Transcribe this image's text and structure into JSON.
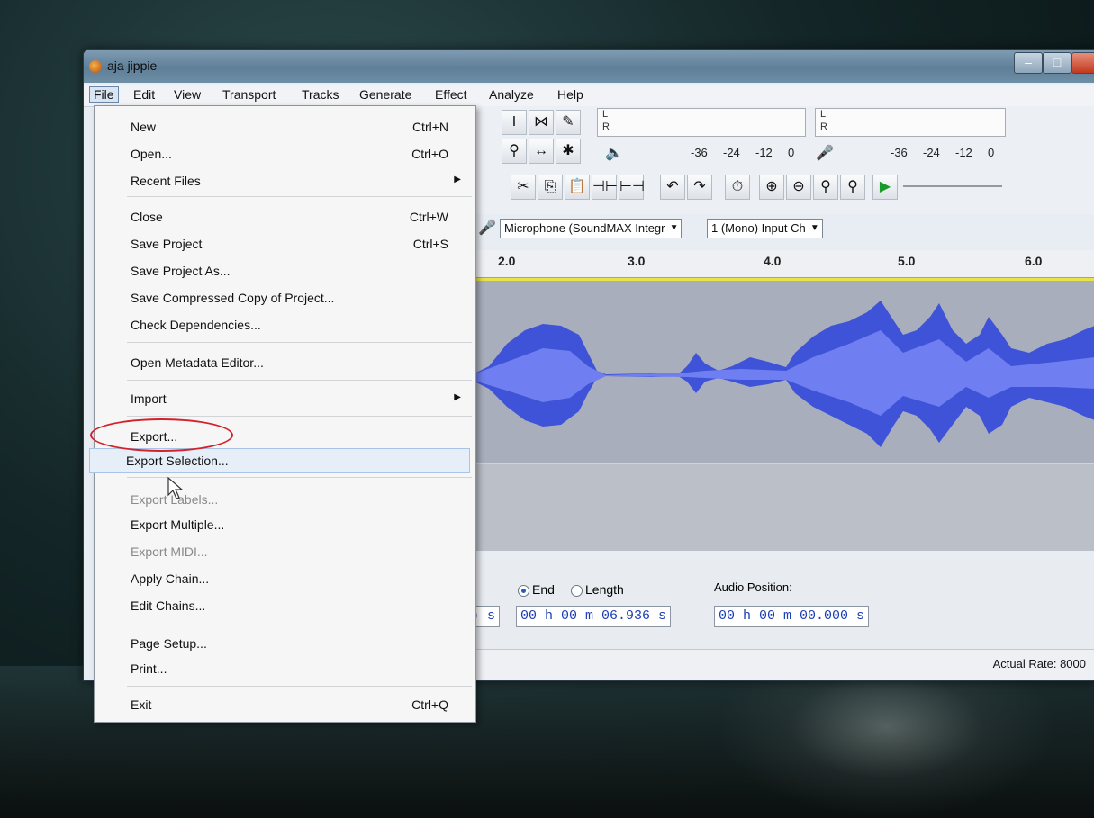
{
  "window": {
    "title": "aja jippie"
  },
  "menubar": [
    "File",
    "Edit",
    "View",
    "Transport",
    "Tracks",
    "Generate",
    "Effect",
    "Analyze",
    "Help"
  ],
  "file_menu": {
    "items": [
      {
        "label": "New",
        "shortcut": "Ctrl+N"
      },
      {
        "label": "Open...",
        "shortcut": "Ctrl+O"
      },
      {
        "label": "Recent Files",
        "shortcut": ""
      },
      {
        "label": "Close",
        "shortcut": "Ctrl+W"
      },
      {
        "label": "Save Project",
        "shortcut": "Ctrl+S"
      },
      {
        "label": "Save Project As...",
        "shortcut": ""
      },
      {
        "label": "Save Compressed Copy of Project...",
        "shortcut": ""
      },
      {
        "label": "Check Dependencies...",
        "shortcut": ""
      },
      {
        "label": "Open Metadata Editor...",
        "shortcut": ""
      },
      {
        "label": "Import",
        "shortcut": ""
      },
      {
        "label": "Export...",
        "shortcut": ""
      },
      {
        "label": "Export Selection...",
        "shortcut": ""
      },
      {
        "label": "Export Labels...",
        "shortcut": ""
      },
      {
        "label": "Export Multiple...",
        "shortcut": ""
      },
      {
        "label": "Export MIDI...",
        "shortcut": ""
      },
      {
        "label": "Apply Chain...",
        "shortcut": ""
      },
      {
        "label": "Edit Chains...",
        "shortcut": ""
      },
      {
        "label": "Page Setup...",
        "shortcut": ""
      },
      {
        "label": "Print...",
        "shortcut": ""
      },
      {
        "label": "Exit",
        "shortcut": "Ctrl+Q"
      }
    ]
  },
  "meters": {
    "play_l": "L",
    "play_r": "R",
    "rec_l": "L",
    "rec_r": "R",
    "scale": [
      "-36",
      "-24",
      "-12",
      "0"
    ]
  },
  "devices": {
    "input_device": "Microphone (SoundMAX Integr",
    "input_channels": "1 (Mono) Input Ch"
  },
  "ruler": [
    "2.0",
    "3.0",
    "4.0",
    "5.0",
    "6.0"
  ],
  "selection": {
    "end_label": "End",
    "length_label": "Length",
    "audio_position_label": "Audio Position:",
    "start_suffix": ") s",
    "end_time": "00 h 00 m 06.936 s",
    "audio_position": "00 h 00 m 00.000 s"
  },
  "status": {
    "actual_rate": "Actual Rate: 8000"
  },
  "colors": {
    "waveform": "#3f53d8",
    "waveform_rms": "#6f7ef0",
    "highlight_oval": "#d3222a",
    "selection_edge": "#e9e24a"
  }
}
